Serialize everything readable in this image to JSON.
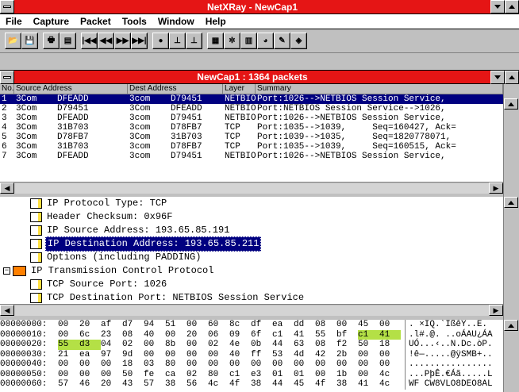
{
  "app": {
    "title": "NetXRay - NewCap1"
  },
  "menu": [
    "File",
    "Capture",
    "Packet",
    "Tools",
    "Window",
    "Help"
  ],
  "toolbar": {
    "groups": [
      [
        {
          "name": "open-icon",
          "glyph": "📂"
        },
        {
          "name": "save-icon",
          "glyph": "💾"
        }
      ],
      [
        {
          "name": "print-icon",
          "glyph": "🖶"
        },
        {
          "name": "print-preview-icon",
          "glyph": "▤"
        }
      ],
      [
        {
          "name": "first-packet-icon",
          "glyph": "|◀◀"
        },
        {
          "name": "prev-packet-icon",
          "glyph": "◀◀"
        },
        {
          "name": "next-packet-icon",
          "glyph": "▶▶"
        },
        {
          "name": "last-packet-icon",
          "glyph": "▶▶|"
        }
      ],
      [
        {
          "name": "stop-icon",
          "glyph": "●"
        },
        {
          "name": "filter-icon",
          "glyph": "⊥"
        },
        {
          "name": "trigger-icon",
          "glyph": "⊥"
        }
      ],
      [
        {
          "name": "decode-icon",
          "glyph": "▦"
        },
        {
          "name": "network-icon",
          "glyph": "✲"
        },
        {
          "name": "chart-icon",
          "glyph": "▥"
        },
        {
          "name": "pie-icon",
          "glyph": "◕"
        },
        {
          "name": "tools-icon",
          "glyph": "✎"
        },
        {
          "name": "settings-icon",
          "glyph": "◈"
        }
      ]
    ]
  },
  "capture_window": {
    "title": "NewCap1 : 1364 packets",
    "columns": [
      "No.",
      "Source Address",
      "Dest Address",
      "Layer",
      "Summary"
    ],
    "packets": [
      {
        "no": "1",
        "src_vendor": "3Com",
        "src": "DFEADD",
        "dst_vendor": "3com",
        "dst": "D79451",
        "layer": "NETBIO",
        "summary": "Port:1026-->NETBIOS Session Service,",
        "selected": true
      },
      {
        "no": "2",
        "src_vendor": "3Com",
        "src": "D79451",
        "dst_vendor": "3Com",
        "dst": "DFEADD",
        "layer": "NETBIO",
        "summary": "Port:NETBIOS Session Service-->1026,",
        "selected": false
      },
      {
        "no": "3",
        "src_vendor": "3Com",
        "src": "DFEADD",
        "dst_vendor": "3com",
        "dst": "D79451",
        "layer": "NETBIO",
        "summary": "Port:1026-->NETBIOS Session Service,",
        "selected": false
      },
      {
        "no": "4",
        "src_vendor": "3Com",
        "src": "31B703",
        "dst_vendor": "3com",
        "dst": "D78FB7",
        "layer": "TCP",
        "summary": "Port:1035-->1039,     Seq=160427, Ack=",
        "selected": false
      },
      {
        "no": "5",
        "src_vendor": "3Com",
        "src": "D78FB7",
        "dst_vendor": "3Com",
        "dst": "31B703",
        "layer": "TCP",
        "summary": "Port:1039-->1035,     Seq=1820778071,",
        "selected": false
      },
      {
        "no": "6",
        "src_vendor": "3Com",
        "src": "31B703",
        "dst_vendor": "3com",
        "dst": "D78FB7",
        "layer": "TCP",
        "summary": "Port:1035-->1039,     Seq=160515, Ack=",
        "selected": false
      },
      {
        "no": "7",
        "src_vendor": "3Com",
        "src": "DFEADD",
        "dst_vendor": "3com",
        "dst": "D79451",
        "layer": "NETBIO",
        "summary": "Port:1026-->NETBIOS Session Service,",
        "selected": false
      }
    ]
  },
  "decode_tree": [
    {
      "label": "IP Protocol Type: TCP",
      "indent": 2,
      "type": "doc",
      "selected": false
    },
    {
      "label": "Header Checksum: 0x96F",
      "indent": 2,
      "type": "doc",
      "selected": false
    },
    {
      "label": "IP Source Address: 193.65.85.191",
      "indent": 2,
      "type": "doc",
      "selected": false
    },
    {
      "label": "IP Destination Address: 193.65.85.211",
      "indent": 2,
      "type": "doc",
      "selected": true
    },
    {
      "label": "Options (including PADDING)",
      "indent": 2,
      "type": "doc",
      "selected": false
    },
    {
      "label": "IP Transmission Control Protocol",
      "indent": 0,
      "type": "folder",
      "selected": false
    },
    {
      "label": "TCP Source Port: 1026",
      "indent": 2,
      "type": "doc",
      "selected": false
    },
    {
      "label": "TCP Destination Port: NETBIOS Session Service",
      "indent": 2,
      "type": "doc",
      "selected": false
    }
  ],
  "hex_dump": [
    {
      "offset": "00000000:",
      "bytes": [
        "00",
        "20",
        "af",
        "d7",
        "94",
        "51",
        "00",
        "60",
        "8c",
        "df",
        "ea",
        "dd",
        "08",
        "00",
        "45",
        "00"
      ],
      "ascii": ". ×IQ.`ÌßêÝ..E."
    },
    {
      "offset": "00000010:",
      "bytes": [
        "00",
        "6c",
        "23",
        "08",
        "40",
        "00",
        "20",
        "06",
        "09",
        "6f",
        "c1",
        "41",
        "55",
        "bf",
        "c1",
        "41"
      ],
      "ascii": ".l#.@. ..oÁAU¿ÁA"
    },
    {
      "offset": "00000020:",
      "bytes": [
        "55",
        "d3",
        "04",
        "02",
        "00",
        "8b",
        "00",
        "02",
        "4e",
        "0b",
        "44",
        "63",
        "08",
        "f2",
        "50",
        "18"
      ],
      "ascii": "UÓ...‹..N.Dc.òP."
    },
    {
      "offset": "00000030:",
      "bytes": [
        "21",
        "ea",
        "97",
        "9d",
        "00",
        "00",
        "00",
        "00",
        "40",
        "ff",
        "53",
        "4d",
        "42",
        "2b",
        "00",
        "00"
      ],
      "ascii": "!ê—.....@ÿSMB+.."
    },
    {
      "offset": "00000040:",
      "bytes": [
        "00",
        "00",
        "00",
        "18",
        "03",
        "80",
        "00",
        "00",
        "00",
        "00",
        "00",
        "00",
        "00",
        "00",
        "00",
        "00"
      ],
      "ascii": "................"
    },
    {
      "offset": "00000050:",
      "bytes": [
        "00",
        "00",
        "00",
        "50",
        "fe",
        "ca",
        "02",
        "80",
        "c1",
        "e3",
        "01",
        "01",
        "00",
        "1b",
        "00",
        "4c"
      ],
      "ascii": "...PþÊ.€Áã.....L"
    },
    {
      "offset": "00000060:",
      "bytes": [
        "57",
        "46",
        "20",
        "43",
        "57",
        "38",
        "56",
        "4c",
        "4f",
        "38",
        "44",
        "45",
        "4f",
        "38",
        "41",
        "4c"
      ],
      "ascii": "WF CW8VLO8DEO8AL"
    }
  ],
  "highlight": {
    "row1": [
      14,
      15
    ],
    "row2": [
      0,
      1
    ]
  }
}
